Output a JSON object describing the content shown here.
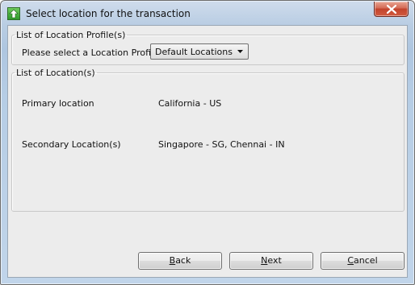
{
  "window": {
    "title": "Select location for the transaction",
    "close_icon": "close-icon",
    "app_icon": "green-up-arrow-icon"
  },
  "profile_group": {
    "legend": "List of Location Profile(s)",
    "prompt": "Please select a Location Profile",
    "select": {
      "value": "Default Locations",
      "arrow_icon": "chevron-down-icon"
    }
  },
  "locations_group": {
    "legend": "List of Location(s)",
    "rows": [
      {
        "label": "Primary location",
        "value": "California - US"
      },
      {
        "label": "Secondary Location(s)",
        "value": "Singapore - SG, Chennai - IN"
      }
    ]
  },
  "buttons": {
    "back": {
      "mnemonic": "B",
      "rest": "ack"
    },
    "next": {
      "mnemonic": "N",
      "rest": "ext"
    },
    "cancel": {
      "mnemonic": "C",
      "rest": "ancel"
    }
  },
  "colors": {
    "close_button": "#c2432c",
    "app_icon": "#2f9a2b"
  }
}
